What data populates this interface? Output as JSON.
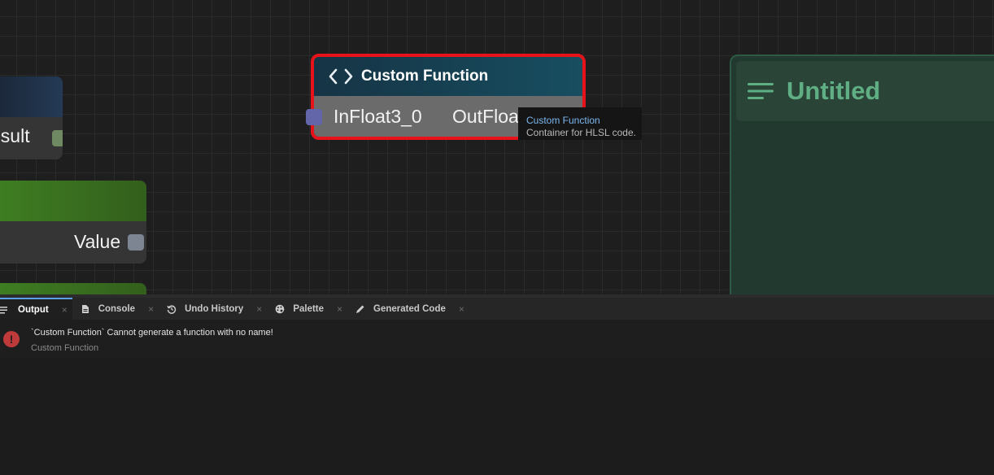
{
  "canvas": {
    "nodes": [
      {
        "id": "node-a",
        "port_label": "esult",
        "port_color": "#6f8a62"
      },
      {
        "id": "node-b",
        "port_label": "Value",
        "port_color": "#7d8593"
      }
    ],
    "custom_function_node": {
      "title": "Custom Function",
      "icon": "code-icon",
      "input_label": "InFloat3_0",
      "output_label": "OutFloat",
      "input_port_color": "#6366a8",
      "selected_outline_color": "#e8131a"
    },
    "group": {
      "title": "Untitled",
      "icon": "menu-lines-icon"
    },
    "tooltip": {
      "title": "Custom Function",
      "description": "Container for HLSL code."
    }
  },
  "panel": {
    "tabs": [
      {
        "label": "Output",
        "icon": "lines-icon",
        "active": true
      },
      {
        "label": "Console",
        "icon": "document-icon",
        "active": false
      },
      {
        "label": "Undo History",
        "icon": "history-icon",
        "active": false
      },
      {
        "label": "Palette",
        "icon": "palette-icon",
        "active": false
      },
      {
        "label": "Generated Code",
        "icon": "pencil-icon",
        "active": false
      }
    ],
    "close_glyph": "×",
    "log": [
      {
        "severity": "error",
        "icon_glyph": "!",
        "message": "`Custom Function` Cannot generate a function with no name!",
        "source": "Custom Function"
      }
    ]
  }
}
